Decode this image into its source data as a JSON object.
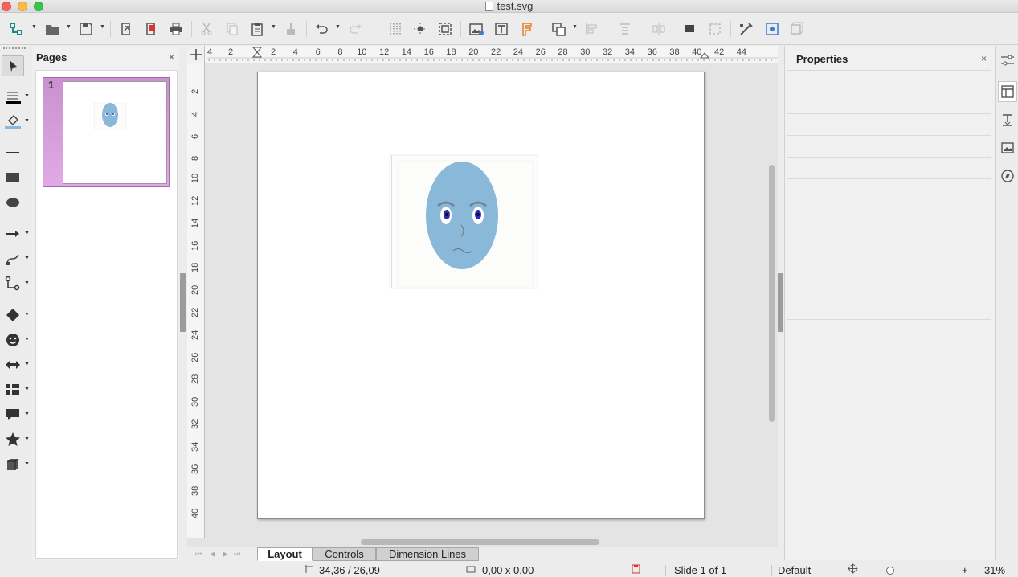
{
  "window": {
    "title": "test.svg"
  },
  "pages_panel": {
    "title": "Pages",
    "close": "×",
    "thumbnails": [
      {
        "number": "1"
      }
    ]
  },
  "properties_panel": {
    "title": "Properties",
    "close": "×"
  },
  "rulers": {
    "horizontal": [
      "4",
      "2",
      "2",
      "4",
      "6",
      "8",
      "10",
      "12",
      "14",
      "16",
      "18",
      "20",
      "22",
      "24",
      "26",
      "28",
      "30",
      "32",
      "34",
      "36",
      "38",
      "40",
      "42",
      "44"
    ],
    "vertical": [
      "2",
      "4",
      "6",
      "8",
      "10",
      "12",
      "14",
      "16",
      "18",
      "20",
      "22",
      "24",
      "26",
      "28",
      "30",
      "32",
      "34",
      "36",
      "38",
      "40"
    ]
  },
  "tabs": [
    {
      "label": "Layout",
      "active": true
    },
    {
      "label": "Controls",
      "active": false
    },
    {
      "label": "Dimension Lines",
      "active": false
    }
  ],
  "status": {
    "position": "34,36 / 26,09",
    "size": "0,00 x 0,00",
    "slide": "Slide 1 of 1",
    "master": "Default",
    "zoom_minus": "–",
    "zoom_plus": "+",
    "zoom": "31%",
    "zoom_fraction": 0.31
  },
  "colors": {
    "face": "#8ab8d8",
    "thumb_selected": "#d49ed9",
    "eye_iris": "#2b2bb8"
  },
  "icons": {
    "toolbar": [
      "shape-select-icon",
      "open-icon",
      "save-icon",
      "export-icon",
      "export-pdf-icon",
      "print-icon",
      "cut-icon",
      "copy-icon",
      "paste-icon",
      "clone-formatting-icon",
      "undo-icon",
      "redo-icon",
      "grid-icon",
      "snap-guides-icon",
      "zoom-pan-icon",
      "insert-image-icon",
      "insert-textbox-icon",
      "fontwork-icon",
      "transformations-icon",
      "align-icon",
      "arrange-icon",
      "distribute-icon",
      "shadow-icon",
      "crop-icon",
      "points-icon",
      "toggle-extrusion-icon",
      "glue-points-icon"
    ],
    "left": [
      "select-icon",
      "line-color-icon",
      "fill-color-icon",
      "line-icon",
      "rectangle-icon",
      "ellipse-icon",
      "arrow-line-icon",
      "curve-icon",
      "connector-icon",
      "basic-shapes-icon",
      "symbol-shapes-icon",
      "block-arrows-icon",
      "flowchart-icon",
      "callouts-icon",
      "stars-icon",
      "3d-objects-icon"
    ]
  }
}
